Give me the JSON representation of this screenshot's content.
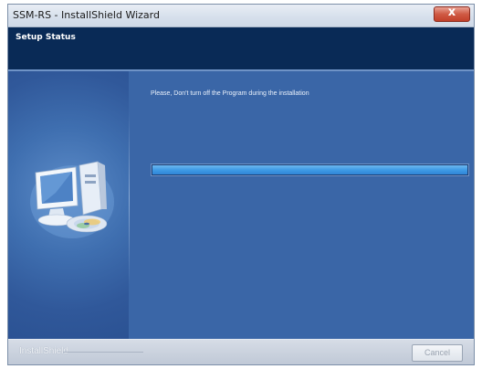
{
  "window": {
    "title": "SSM-RS - InstallShield Wizard",
    "close_label": "x"
  },
  "header": {
    "title": "Setup Status"
  },
  "main": {
    "status_message": "Please, Don't turn off the Program during the installation",
    "progress_percent": 100
  },
  "footer": {
    "brand": "InstallShield",
    "cancel_label": "Cancel"
  },
  "colors": {
    "header_band": "#092a56",
    "body_background": "#3a66a7",
    "progress_fill": "#3f9be6"
  },
  "icons": {
    "illustration": "computer-with-disc-icon"
  }
}
